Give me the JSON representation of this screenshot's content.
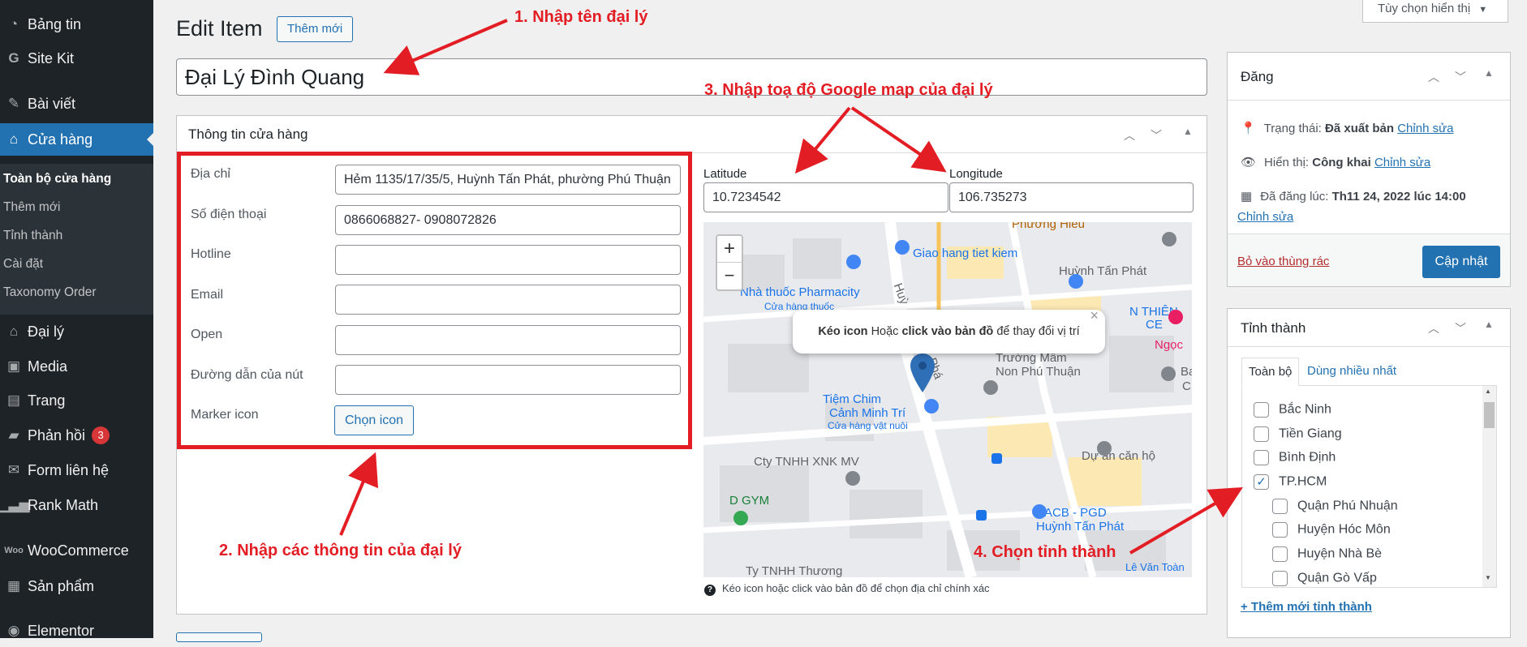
{
  "sidebar": {
    "items": [
      {
        "label": "Bảng tin",
        "icon": "dashboard-icon"
      },
      {
        "label": "Site Kit",
        "icon": "google-g-icon"
      },
      {
        "label": "Bài viết",
        "icon": "pin-icon"
      },
      {
        "label": "Cửa hàng",
        "icon": "store-icon"
      },
      {
        "label": "Đại lý",
        "icon": "home-icon"
      },
      {
        "label": "Media",
        "icon": "media-icon"
      },
      {
        "label": "Trang",
        "icon": "page-icon"
      },
      {
        "label": "Phản hồi",
        "icon": "comment-icon",
        "badge": "3"
      },
      {
        "label": "Form liên hệ",
        "icon": "mail-icon"
      },
      {
        "label": "Rank Math",
        "icon": "chart-icon"
      },
      {
        "label": "WooCommerce",
        "icon": "woo-icon"
      },
      {
        "label": "Sản phẩm",
        "icon": "archive-icon"
      },
      {
        "label": "Elementor",
        "icon": "elementor-icon"
      }
    ],
    "submenu": [
      "Toàn bộ cửa hàng",
      "Thêm mới",
      "Tỉnh thành",
      "Cài đặt",
      "Taxonomy Order"
    ]
  },
  "header": {
    "title": "Edit Item",
    "add_new": "Thêm mới",
    "screen_options": "Tùy chọn hiển thị"
  },
  "post_title": "Đại Lý Đình Quang",
  "store_box": {
    "title": "Thông tin cửa hàng",
    "fields": [
      {
        "label": "Địa chỉ",
        "value": "Hẻm 1135/17/35/5, Huỳnh Tấn Phát, phường Phú Thuận"
      },
      {
        "label": "Số điện thoại",
        "value": "0866068827- 0908072826"
      },
      {
        "label": "Hotline",
        "value": ""
      },
      {
        "label": "Email",
        "value": ""
      },
      {
        "label": "Open",
        "value": ""
      },
      {
        "label": "Đường dẫn của nút",
        "value": ""
      }
    ],
    "marker_label": "Marker icon",
    "marker_button": "Chọn icon",
    "latitude_label": "Latitude",
    "latitude_value": "10.7234542",
    "longitude_label": "Longitude",
    "longitude_value": "106.735273",
    "map_hint": "Kéo icon hoặc click vào bản đồ để chọn địa chỉ chính xác",
    "popup": {
      "bold1": "Kéo icon",
      "t1": " Hoặc ",
      "bold2": "click vào bản đồ",
      "t2": " để thay đổi vị trí"
    },
    "zoom_in": "+",
    "zoom_out": "−"
  },
  "map_labels": {
    "l1": "Giao hang tiet kiem",
    "l2": "Huỳnh Tấn Phát",
    "l3": "Nhà thuốc Pharmacity",
    "l4": "Cửa hàng thuốc",
    "l5": "N THIÊN",
    "l6": "CE",
    "l7": "Ngọc",
    "l8": "Trường Mầm",
    "l9": "Non Phú Thuận",
    "l10": "Tiệm Chim",
    "l11": "Cảnh Minh Trí",
    "l12": "Cửa hàng vật nuôi",
    "l13": "Cty TNHH XNK MV",
    "l14": "Dự án căn hộ",
    "l15": "D GYM",
    "l16": "ACB - PGD",
    "l17": "Huỳnh Tấn Phát",
    "l18": "Ty TNHH Thương",
    "l19": "Lê Văn Toàn",
    "l20": "Huỳ",
    "l21": "Phá",
    "l22": "Phương Hiếu",
    "l23": "Ba",
    "l24": "C"
  },
  "publish": {
    "title": "Đăng",
    "status_label": "Trạng thái:",
    "status_value": "Đã xuất bản",
    "visibility_label": "Hiển thị:",
    "visibility_value": "Công khai",
    "date_label": "Đã đăng lúc:",
    "date_value": "Th11 24, 2022 lúc 14:00",
    "edit": "Chỉnh sửa",
    "trash": "Bỏ vào thùng rác",
    "update": "Cập nhật"
  },
  "province": {
    "title": "Tỉnh thành",
    "tab_all": "Toàn bộ",
    "tab_popular": "Dùng nhiều nhất",
    "items": [
      {
        "label": "Bắc Ninh",
        "checked": false,
        "child": false
      },
      {
        "label": "Tiền Giang",
        "checked": false,
        "child": false
      },
      {
        "label": "Bình Định",
        "checked": false,
        "child": false
      },
      {
        "label": "TP.HCM",
        "checked": true,
        "child": false
      },
      {
        "label": "Quận Phú Nhuận",
        "checked": false,
        "child": true
      },
      {
        "label": "Huyện Hóc Môn",
        "checked": false,
        "child": true
      },
      {
        "label": "Huyện Nhà Bè",
        "checked": false,
        "child": true
      },
      {
        "label": "Quận Gò Vấp",
        "checked": false,
        "child": true
      }
    ],
    "add_new": "+ Thêm mới tỉnh thành"
  },
  "annotations": {
    "a1": "1. Nhập tên đại lý",
    "a2": "2. Nhập các thông tin của đại lý",
    "a3": "3. Nhập toạ độ Google map của đại lý",
    "a4": "4. Chọn tỉnh thành"
  },
  "colors": {
    "accent": "#2271b1",
    "annotation": "#e31d24",
    "sidebar": "#1d2327"
  }
}
